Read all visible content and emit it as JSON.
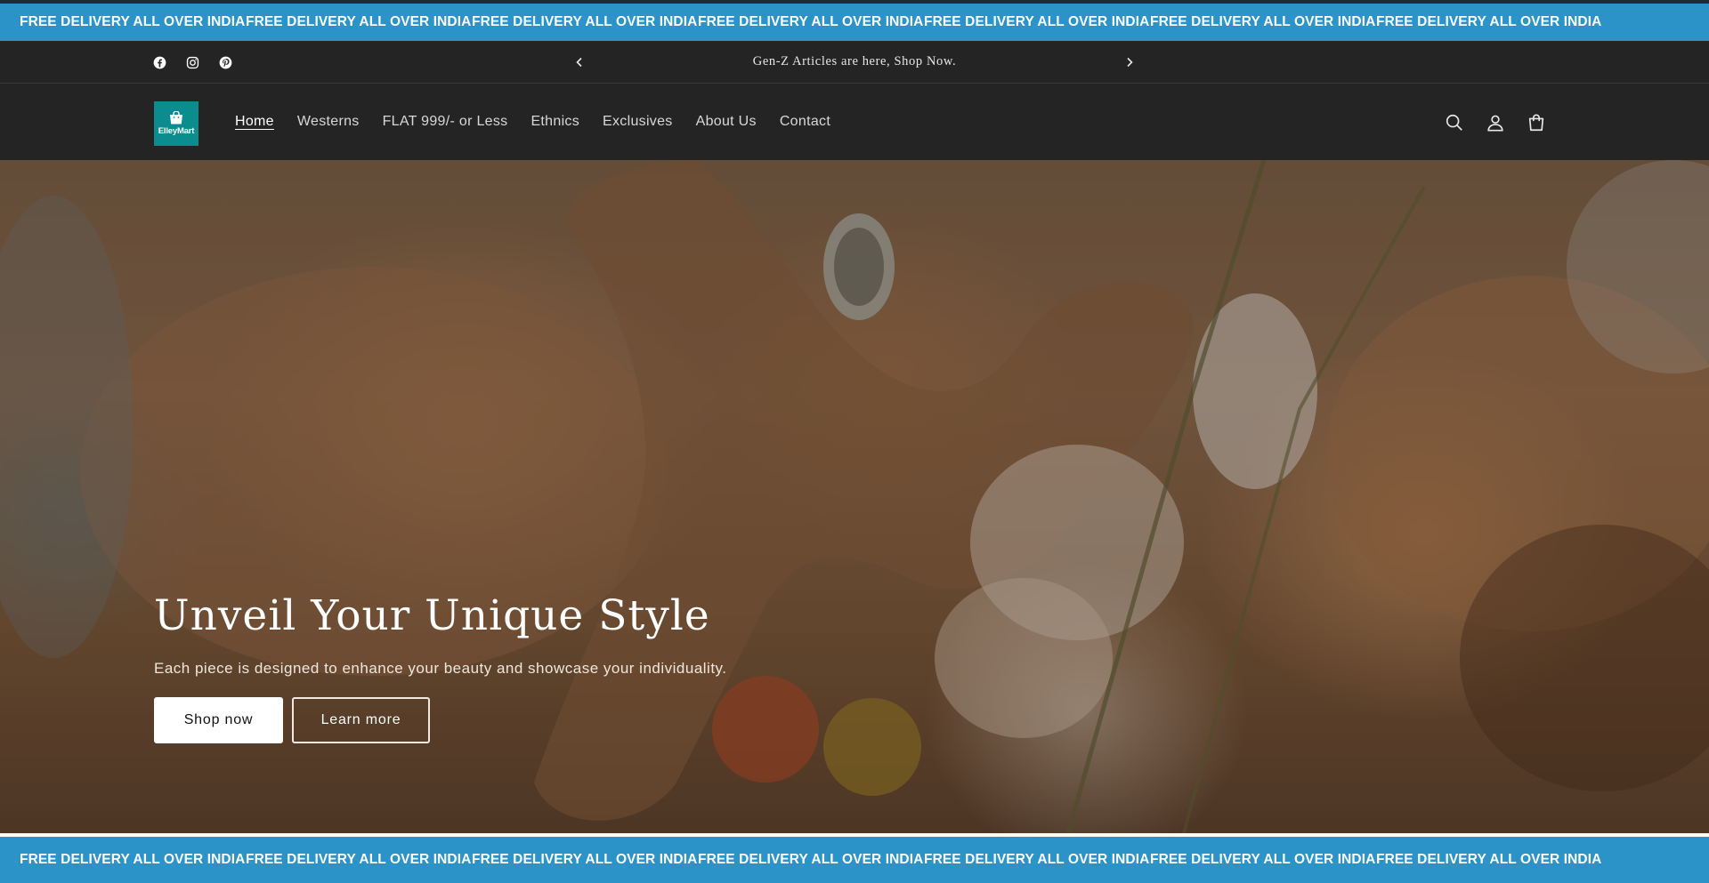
{
  "marquee": {
    "items": [
      "FREE DELIVERY ALL OVER INDIA",
      "FREE DELIVERY ALL OVER INDIA",
      "FREE DELIVERY ALL OVER INDIA",
      "FREE DELIVERY ALL OVER INDIA",
      "FREE DELIVERY ALL OVER INDIA",
      "FREE DELIVERY ALL OVER INDIA",
      "FREE DELIVERY ALL OVER INDIA"
    ],
    "color": "#2b93c7"
  },
  "announcement": {
    "text": "Gen-Z Articles are here, Shop Now.",
    "prev_icon": "chevron-left-icon",
    "next_icon": "chevron-right-icon"
  },
  "socials": [
    "facebook-icon",
    "instagram-icon",
    "pinterest-icon"
  ],
  "header": {
    "logo_text": "ElleyMart",
    "logo_color": "#0b8d8f",
    "nav": [
      {
        "label": "Home",
        "active": true
      },
      {
        "label": "Westerns"
      },
      {
        "label": "FLAT 999/- or Less"
      },
      {
        "label": "Ethnics"
      },
      {
        "label": "Exclusives"
      },
      {
        "label": "About Us"
      },
      {
        "label": "Contact"
      }
    ],
    "icons": [
      "search-icon",
      "account-icon",
      "cart-icon"
    ]
  },
  "hero": {
    "title": "Unveil Your Unique Style",
    "subtitle": "Each piece is designed to enhance your beauty and showcase your individuality.",
    "primary_button": "Shop now",
    "secondary_button": "Learn more"
  }
}
